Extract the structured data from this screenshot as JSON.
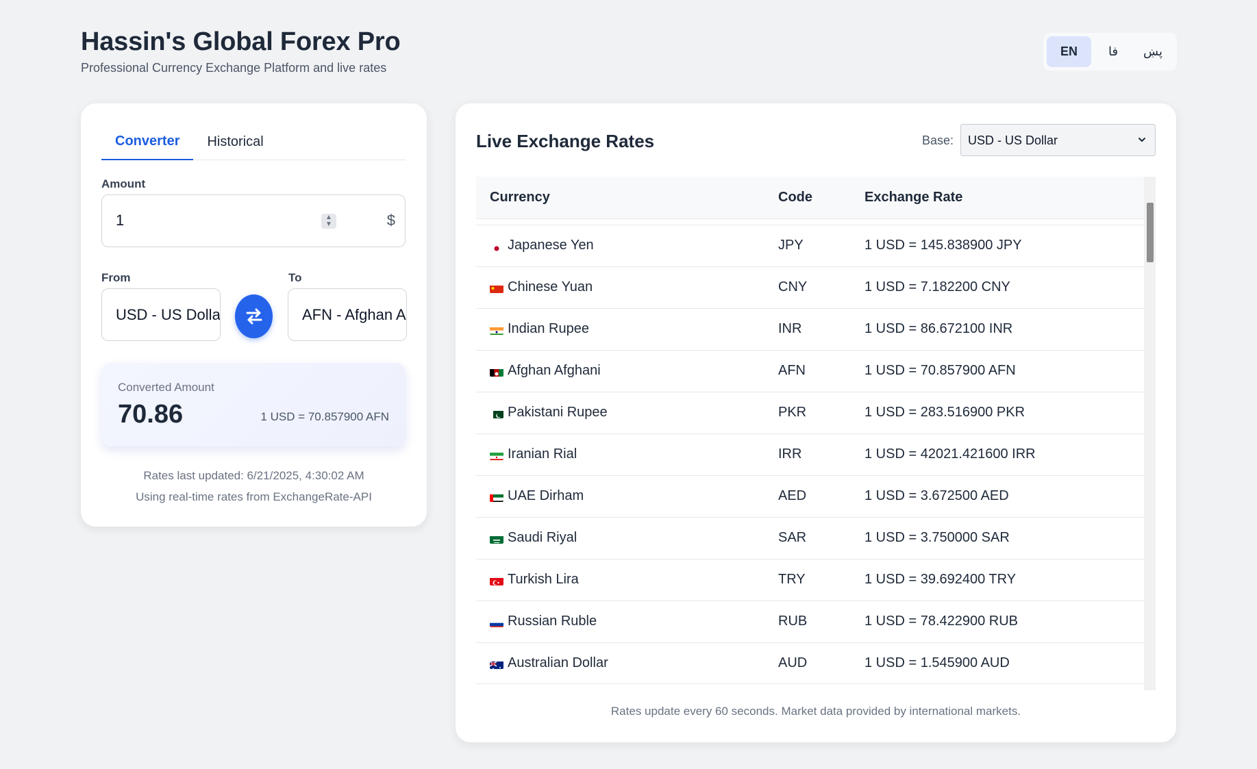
{
  "header": {
    "title": "Hassin's Global Forex Pro",
    "subtitle": "Professional Currency Exchange Platform and live rates"
  },
  "language": {
    "options": [
      "EN",
      "فا",
      "پښ"
    ],
    "selected": "EN"
  },
  "converter": {
    "tabs": [
      "Converter",
      "Historical"
    ],
    "active_tab": "Converter",
    "amount_label": "Amount",
    "amount_value": "1",
    "amount_symbol": "$",
    "from_label": "From",
    "from_value": "USD - US Dollar",
    "to_label": "To",
    "to_value": "AFN - Afghan Afghani",
    "result_label": "Converted Amount",
    "result_value": "70.86",
    "result_rate": "1 USD = 70.857900 AFN",
    "updated_text": "Rates last updated: 6/21/2025, 4:30:02 AM",
    "source_text": "Using real-time rates from ExchangeRate-API"
  },
  "rates": {
    "title": "Live Exchange Rates",
    "base_label": "Base:",
    "base_value": "USD - US Dollar",
    "columns": [
      "Currency",
      "Code",
      "Exchange Rate"
    ],
    "rows": [
      {
        "flag": "jp",
        "name": "Japanese Yen",
        "code": "JPY",
        "rate": "1 USD = 145.838900 JPY"
      },
      {
        "flag": "cn",
        "name": "Chinese Yuan",
        "code": "CNY",
        "rate": "1 USD = 7.182200 CNY"
      },
      {
        "flag": "in",
        "name": "Indian Rupee",
        "code": "INR",
        "rate": "1 USD = 86.672100 INR"
      },
      {
        "flag": "af",
        "name": "Afghan Afghani",
        "code": "AFN",
        "rate": "1 USD = 70.857900 AFN"
      },
      {
        "flag": "pk",
        "name": "Pakistani Rupee",
        "code": "PKR",
        "rate": "1 USD = 283.516900 PKR"
      },
      {
        "flag": "ir",
        "name": "Iranian Rial",
        "code": "IRR",
        "rate": "1 USD = 42021.421600 IRR"
      },
      {
        "flag": "ae",
        "name": "UAE Dirham",
        "code": "AED",
        "rate": "1 USD = 3.672500 AED"
      },
      {
        "flag": "sa",
        "name": "Saudi Riyal",
        "code": "SAR",
        "rate": "1 USD = 3.750000 SAR"
      },
      {
        "flag": "tr",
        "name": "Turkish Lira",
        "code": "TRY",
        "rate": "1 USD = 39.692400 TRY"
      },
      {
        "flag": "ru",
        "name": "Russian Ruble",
        "code": "RUB",
        "rate": "1 USD = 78.422900 RUB"
      },
      {
        "flag": "au",
        "name": "Australian Dollar",
        "code": "AUD",
        "rate": "1 USD = 1.545900 AUD"
      }
    ],
    "footer": "Rates update every 60 seconds. Market data provided by international markets."
  },
  "colors": {
    "accent": "#2563eb",
    "background": "#f1f2f4",
    "active_lang_bg": "#dbe4fb"
  }
}
